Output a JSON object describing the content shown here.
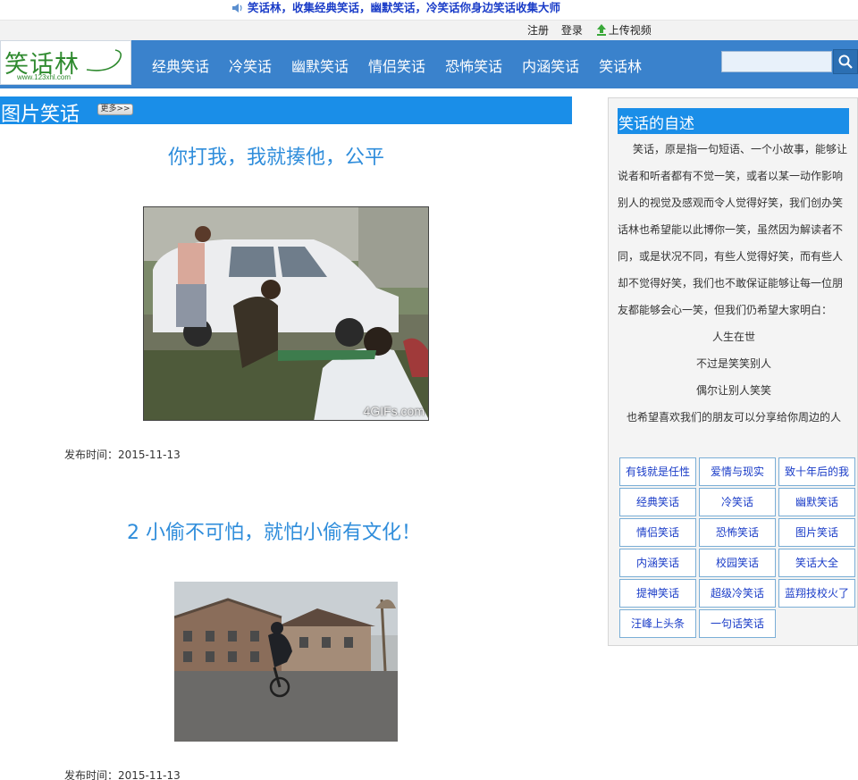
{
  "header": {
    "slogan": "笑话林，收集经典笑话，幽默笑话，冷笑话你身边笑话收集大师",
    "register": "注册",
    "login": "登录",
    "upload": "上传视频"
  },
  "logo": {
    "name": "笑话林",
    "url": "www.123xhl.com"
  },
  "nav": {
    "items": [
      "经典笑话",
      "冷笑话",
      "幽默笑话",
      "情侣笑话",
      "恐怖笑话",
      "内涵笑话",
      "笑话林"
    ]
  },
  "search": {
    "placeholder": ""
  },
  "section": {
    "title": "图片笑话",
    "more": "更多>>"
  },
  "posts": [
    {
      "title": "你打我，我就揍他，公平",
      "watermark": "4GIFs.com",
      "date": "发布时间：2015-11-13"
    },
    {
      "title": "2 小偷不可怕，就怕小偷有文化！",
      "date": "发布时间：2015-11-13"
    }
  ],
  "sidebar": {
    "title": "笑话的自述",
    "paragraph": "笑话，原是指一句短语、一个小故事，能够让说者和听者都有不觉一笑，或者以某一动作影响别人的视觉及感观而令人觉得好笑，我们创办笑话林也希望能以此博你一笑，虽然因为解读者不同，或是状况不同，有些人觉得好笑，而有些人却不觉得好笑，我们也不敢保证能够让每一位朋友都能够会心一笑，但我们仍希望大家明白：",
    "lines": [
      "人生在世",
      "不过是笑笑别人",
      "偶尔让别人笑笑",
      "也希望喜欢我们的朋友可以分享给你周边的人"
    ],
    "tags": [
      "有钱就是任性",
      "爱情与现实",
      "致十年后的我",
      "经典笑话",
      "冷笑话",
      "幽默笑话",
      "情侣笑话",
      "恐怖笑话",
      "图片笑话",
      "内涵笑话",
      "校园笑话",
      "笑话大全",
      "提神笑话",
      "超级冷笑话",
      "蓝翔技校火了",
      "汪峰上头条",
      "一句话笑话"
    ]
  },
  "colors": {
    "nav_bg": "#3a82cc",
    "accent_blue": "#1a8ee8",
    "title_blue": "#2f8ddb",
    "link_blue": "#1a3cc8"
  },
  "icons": {
    "speaker": "speaker-icon",
    "upload": "upload-icon",
    "search": "search-icon"
  }
}
